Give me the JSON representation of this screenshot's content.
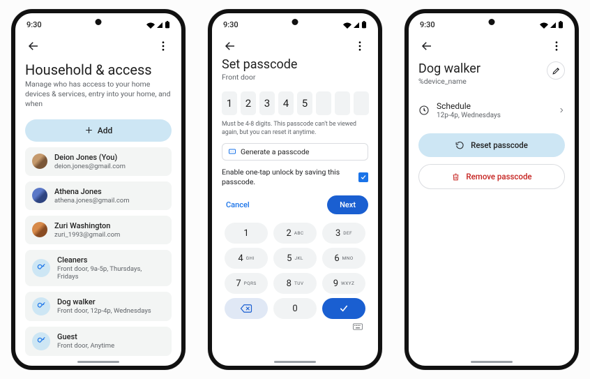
{
  "status": {
    "time": "9:30"
  },
  "screen1": {
    "title": "Household & access",
    "subtitle": "Manage who has access to your home devices & services, entry into your home, and when",
    "add_label": "Add",
    "people": [
      {
        "name": "Deion Jones (You)",
        "email": "deion.jones@gmail.com"
      },
      {
        "name": "Athena Jones",
        "email": "athena.jones@gmail.com"
      },
      {
        "name": "Zuri Washington",
        "email": "zuri_1993@gmail.com"
      }
    ],
    "guests": [
      {
        "name": "Cleaners",
        "detail": "Front door, 9a-5p, Thursdays, Fridays"
      },
      {
        "name": "Dog walker",
        "detail": "Front door, 12p-4p, Wednesdays"
      },
      {
        "name": "Guest",
        "detail": "Front door, Anytime"
      }
    ]
  },
  "screen2": {
    "title": "Set passcode",
    "subtitle": "Front door",
    "digits": [
      "1",
      "2",
      "3",
      "4",
      "5",
      "",
      "",
      ""
    ],
    "helper": "Must be 4-8 digits. This passcode can't be viewed again, but you can reset it anytime.",
    "generate_label": "Generate a passcode",
    "save_label": "Enable one-tap unlock by saving this passcode.",
    "save_checked": true,
    "cancel_label": "Cancel",
    "next_label": "Next",
    "keys": [
      {
        "n": "1",
        "l": ""
      },
      {
        "n": "2",
        "l": "ABC"
      },
      {
        "n": "3",
        "l": "DEF"
      },
      {
        "n": "4",
        "l": "GHI"
      },
      {
        "n": "5",
        "l": "JKL"
      },
      {
        "n": "6",
        "l": "MNO"
      },
      {
        "n": "7",
        "l": "PQRS"
      },
      {
        "n": "8",
        "l": "TUV"
      },
      {
        "n": "9",
        "l": "WXYZ"
      }
    ],
    "zero": "0"
  },
  "screen3": {
    "title": "Dog walker",
    "subtitle": "%device_name",
    "schedule_label": "Schedule",
    "schedule_detail": "12p-4p, Wednesdays",
    "reset_label": "Reset passcode",
    "remove_label": "Remove passcode"
  }
}
